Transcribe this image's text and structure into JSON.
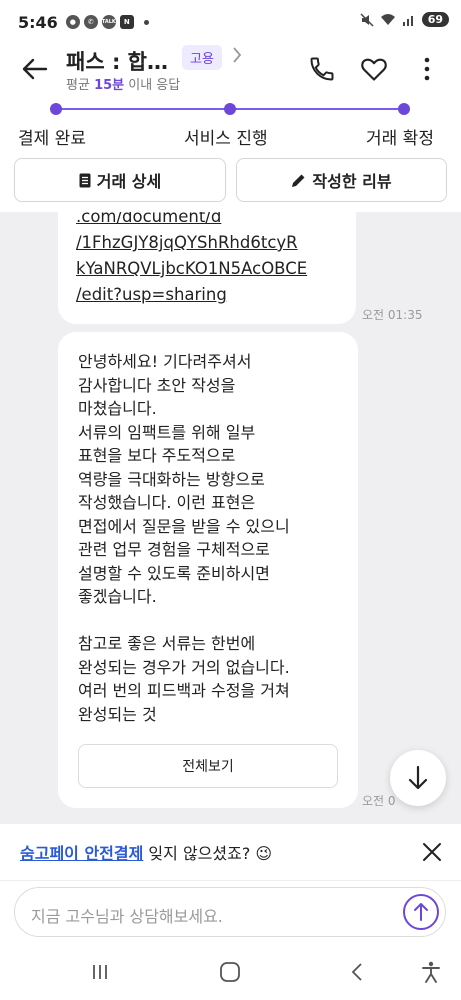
{
  "status_bar": {
    "time": "5:46",
    "battery": "69",
    "talk_label": "TALK",
    "n_label": "N"
  },
  "header": {
    "title": "패스 : 합…",
    "tag": "고용",
    "subtitle_prefix": "평균 ",
    "subtitle_highlight": "15분",
    "subtitle_suffix": " 이내 응답"
  },
  "progress": {
    "steps": [
      {
        "label": "결제 완료"
      },
      {
        "label": "서비스 진행"
      },
      {
        "label": "거래 확정"
      }
    ]
  },
  "actions": {
    "detail_label": "거래 상세",
    "review_label": "작성한 리뷰"
  },
  "chat": {
    "link_lines": [
      ".com/document/d",
      "/1FhzGJY8jqQYShRhd6tcyR",
      "kYaNRQVLjbcKO1N5AcOBCE",
      "/edit?usp=sharing"
    ],
    "link_time": "오전 01:35",
    "message_lines": [
      "안녕하세요! 기다려주셔서",
      "감사합니다 초안 작성을",
      "마쳤습니다.",
      "서류의 임팩트를 위해 일부",
      "표현을 보다 주도적으로",
      "역량을 극대화하는 방향으로",
      "작성했습니다. 이런 표현은",
      "면접에서 질문을 받을 수 있으니",
      "관련 업무 경험을 구체적으로",
      "설명할 수 있도록 준비하시면",
      "좋겠습니다.",
      "",
      "참고로 좋은 서류는 한번에",
      "완성되는 경우가 거의 없습니다.",
      "여러 번의 피드백과 수정을 거쳐",
      "완성되는 것"
    ],
    "view_all_label": "전체보기",
    "message_time": "오전 0"
  },
  "banner": {
    "link_text": "숨고페이 안전결제",
    "text": " 잊지 않으셨죠? 😉"
  },
  "input": {
    "placeholder": "지금 고수님과 상담해보세요."
  },
  "colors": {
    "accent": "#6c47d9",
    "chat_bg": "#efeff1",
    "link_blue": "#2a5ad6"
  }
}
